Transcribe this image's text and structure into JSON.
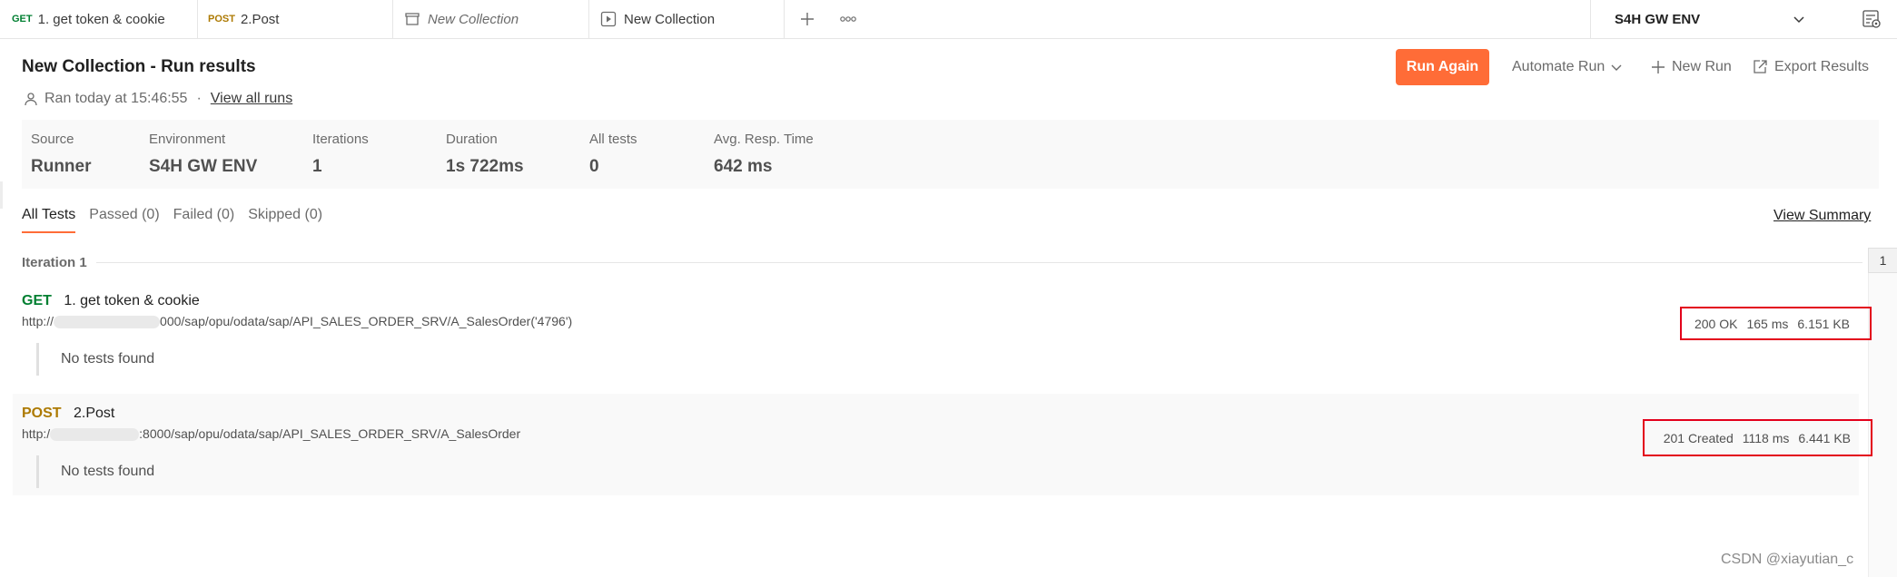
{
  "tabs": [
    {
      "method": "GET",
      "label": "1. get token & cookie"
    },
    {
      "method": "POST",
      "label": "2.Post"
    },
    {
      "label": "New Collection"
    },
    {
      "label": "New Collection"
    }
  ],
  "environment": {
    "selected": "S4H GW ENV"
  },
  "header": {
    "title": "New Collection - Run results",
    "ran_text": "Ran today at 15:46:55",
    "separator": "·",
    "view_all_runs": "View all runs",
    "run_again": "Run Again",
    "automate_run": "Automate Run",
    "new_run": "New Run",
    "export_results": "Export Results"
  },
  "summary": [
    {
      "label": "Source",
      "value": "Runner"
    },
    {
      "label": "Environment",
      "value": "S4H GW ENV"
    },
    {
      "label": "Iterations",
      "value": "1"
    },
    {
      "label": "Duration",
      "value": "1s 722ms"
    },
    {
      "label": "All tests",
      "value": "0"
    },
    {
      "label": "Avg. Resp. Time",
      "value": "642 ms"
    }
  ],
  "filters": {
    "all": "All Tests",
    "passed": "Passed (0)",
    "failed": "Failed (0)",
    "skipped": "Skipped (0)",
    "view_summary": "View Summary"
  },
  "iteration": {
    "label": "Iteration 1",
    "badge": "1"
  },
  "requests": [
    {
      "method": "GET",
      "name": "1. get token & cookie",
      "url_prefix": "http://",
      "url_suffix": "000/sap/opu/odata/sap/API_SALES_ORDER_SRV/A_SalesOrder('4796')",
      "no_tests": "No tests found",
      "status": "200 OK",
      "time": "165 ms",
      "size": "6.151 KB"
    },
    {
      "method": "POST",
      "name": "2.Post",
      "url_prefix": "http:/",
      "url_suffix": ":8000/sap/opu/odata/sap/API_SALES_ORDER_SRV/A_SalesOrder",
      "no_tests": "No tests found",
      "status": "201 Created",
      "time": "1118 ms",
      "size": "6.441 KB"
    }
  ],
  "watermark": "CSDN @xiayutian_c",
  "colors": {
    "accent": "#ff6c37",
    "get": "#007f31",
    "post": "#ad7a03",
    "highlight": "#e3001b"
  }
}
